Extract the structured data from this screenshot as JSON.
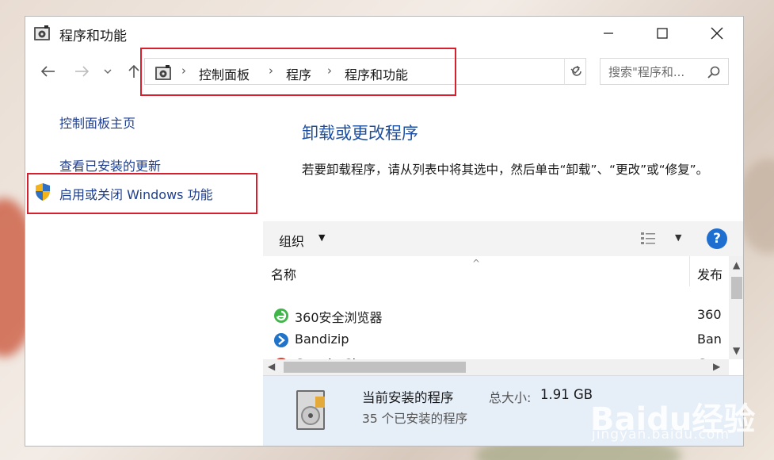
{
  "window": {
    "title": "程序和功能",
    "minimize_label": "Minimize",
    "maximize_label": "Maximize",
    "close_label": "Close"
  },
  "nav": {
    "breadcrumbs": [
      "控制面板",
      "程序",
      "程序和功能"
    ],
    "search_placeholder": "搜索\"程序和..."
  },
  "sidebar": {
    "links": [
      {
        "label": "控制面板主页"
      },
      {
        "label": "查看已安装的更新"
      },
      {
        "label": "启用或关闭 Windows 功能"
      }
    ]
  },
  "main": {
    "title": "卸载或更改程序",
    "description": "若要卸载程序，请从列表中将其选中，然后单击“卸载”、“更改”或“修复”。"
  },
  "toolbar": {
    "organize_label": "组织",
    "help_label": "?"
  },
  "list": {
    "columns": [
      "名称",
      "发布"
    ],
    "rows": [
      {
        "name": "360安全浏览器",
        "publisher": "360",
        "icon": "360-browser-icon"
      },
      {
        "name": "Bandizip",
        "publisher": "Ban",
        "icon": "bandizip-icon"
      },
      {
        "name": "Google Chrome",
        "publisher": "Goo",
        "icon": "chrome-icon"
      }
    ]
  },
  "status": {
    "title": "当前安装的程序",
    "size_label": "总大小:",
    "size_value": "1.91 GB",
    "count_text": "35 个已安装的程序"
  },
  "watermark": {
    "text": "Baidu经验",
    "sub": "jingyan.baidu.com"
  },
  "colors": {
    "link": "#1f3f8f",
    "title_blue": "#1e50a2",
    "highlight_red": "#d7202d",
    "status_bg": "#e6eef8"
  }
}
